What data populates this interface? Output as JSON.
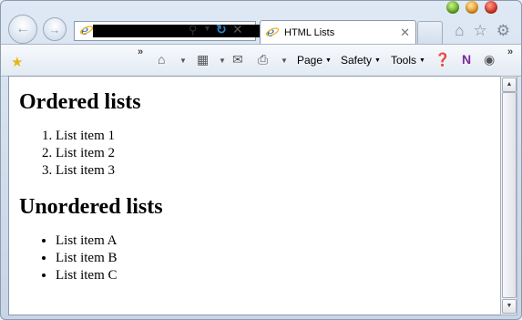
{
  "browser": {
    "tab": {
      "title": "HTML Lists"
    },
    "address": {
      "url_redacted": ""
    },
    "commandbar": {
      "page_label": "Page",
      "safety_label": "Safety",
      "tools_label": "Tools"
    },
    "icons": {
      "back": "back-arrow-icon",
      "forward": "forward-arrow-icon",
      "home": "home-icon",
      "favorites": "star-icon",
      "settings": "gear-icon"
    }
  },
  "page": {
    "ordered_heading": "Ordered lists",
    "ordered_items": [
      "List item 1",
      "List item 2",
      "List item 3"
    ],
    "unordered_heading": "Unordered lists",
    "unordered_items": [
      "List item A",
      "List item B",
      "List item C"
    ]
  }
}
